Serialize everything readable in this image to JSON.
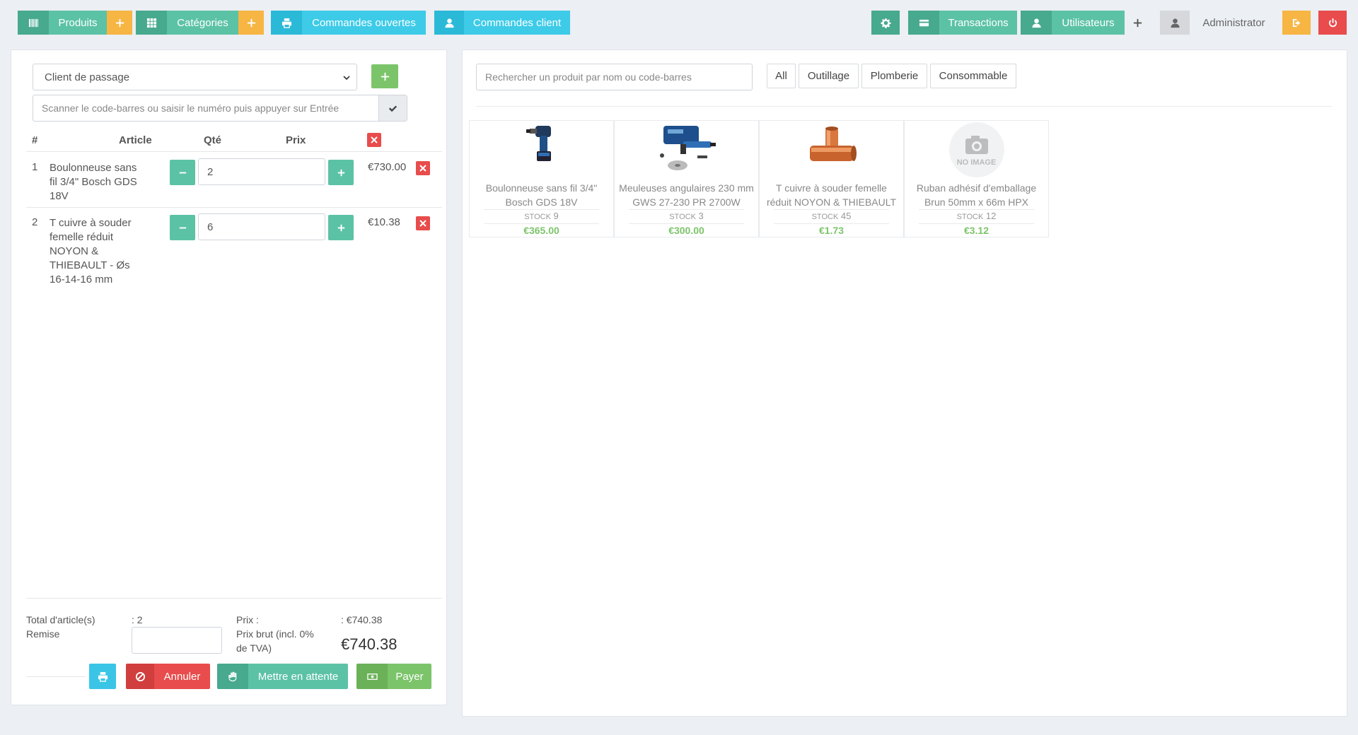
{
  "topbar": {
    "products_label": "Produits",
    "categories_label": "Catégories",
    "open_orders_label": "Commandes ouvertes",
    "customer_orders_label": "Commandes client",
    "transactions_label": "Transactions",
    "users_label": "Utilisateurs",
    "user_name": "Administrator"
  },
  "cart": {
    "customer_select": "Client de passage",
    "barcode_placeholder": "Scanner le code-barres ou saisir le numéro puis appuyer sur Entrée",
    "headers": {
      "num": "#",
      "item": "Article",
      "qty": "Qté",
      "price": "Prix"
    },
    "items": [
      {
        "num": "1",
        "name": "Boulonneuse sans fil 3/4\" Bosch GDS 18V",
        "qty": "2",
        "price": "€730.00"
      },
      {
        "num": "2",
        "name": "T cuivre à souder femelle réduit NOYON & THIEBAULT - Øs 16-14-16 mm",
        "qty": "6",
        "price": "€10.38"
      }
    ],
    "summary": {
      "total_items_label": "Total d'article(s)",
      "total_items_value": ": 2",
      "discount_label": "Remise",
      "price_label": "Prix :",
      "price_value": ": €740.38",
      "gross_label": "Prix brut (incl. 0% de TVA)",
      "gross_value": "€740.38"
    },
    "actions": {
      "cancel": "Annuler",
      "hold": "Mettre en attente",
      "pay": "Payer"
    }
  },
  "catalog": {
    "search_placeholder": "Rechercher un produit par nom ou code-barres",
    "categories": [
      "All",
      "Outillage",
      "Plomberie",
      "Consommable"
    ],
    "stock_label": "STOCK",
    "no_image_label": "NO IMAGE",
    "products": [
      {
        "name": "Boulonneuse sans fil 3/4\" Bosch GDS 18V",
        "stock": "9",
        "price": "€365.00",
        "image": "impact-wrench"
      },
      {
        "name": "Meuleuses angulaires 230 mm GWS 27-230 PR 2700W",
        "stock": "3",
        "price": "€300.00",
        "image": "angle-grinder-kit"
      },
      {
        "name": "T cuivre à souder femelle réduit NOYON & THIEBAULT",
        "stock": "45",
        "price": "€1.73",
        "image": "copper-tee"
      },
      {
        "name": "Ruban adhésif d'emballage Brun 50mm x 66m HPX",
        "stock": "12",
        "price": "€3.12",
        "image": "no-image"
      }
    ]
  },
  "colors": {
    "teal": "#5cc2a6",
    "orange": "#f7b543",
    "cyan": "#3dcbe8",
    "red": "#e84c4c",
    "green": "#7cc46a"
  }
}
